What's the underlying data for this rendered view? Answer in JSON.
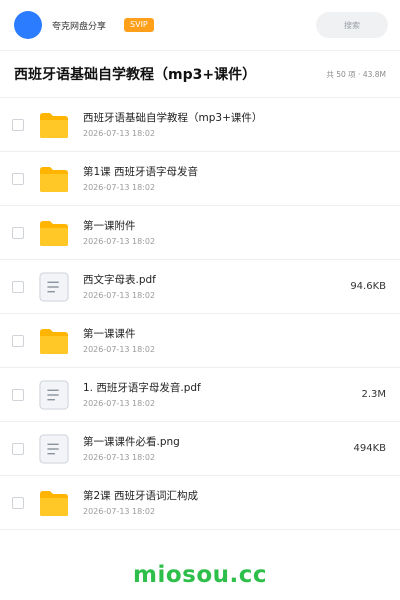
{
  "header": {
    "share_name": "夸克网盘分享",
    "badge": "SVIP",
    "search_placeholder": "搜索"
  },
  "title_bar": {
    "title": "西班牙语基础自学教程（mp3+课件）",
    "meta": "共 50 项 · 43.8M"
  },
  "files": [
    {
      "type": "folder",
      "name": "西班牙语基础自学教程（mp3+课件）",
      "date": "2026-07-13 18:02",
      "size": ""
    },
    {
      "type": "folder",
      "name": "第1课 西班牙语字母发音",
      "date": "2026-07-13 18:02",
      "size": ""
    },
    {
      "type": "folder",
      "name": "第一课附件",
      "date": "2026-07-13 18:02",
      "size": ""
    },
    {
      "type": "file",
      "name": "西文字母表.pdf",
      "date": "2026-07-13 18:02",
      "size": "94.6KB"
    },
    {
      "type": "folder",
      "name": "第一课课件",
      "date": "2026-07-13 18:02",
      "size": ""
    },
    {
      "type": "file",
      "name": "1. 西班牙语字母发音.pdf",
      "date": "2026-07-13 18:02",
      "size": "2.3M"
    },
    {
      "type": "file",
      "name": "第一课课件必看.png",
      "date": "2026-07-13 18:02",
      "size": "494KB"
    },
    {
      "type": "folder",
      "name": "第2课 西班牙语词汇构成",
      "date": "2026-07-13 18:02",
      "size": ""
    }
  ],
  "watermark": "miosou.cc",
  "colors": {
    "avatar": "#2b7cff",
    "badge": "#ff9f1a",
    "folder": "#ffc21a",
    "watermark": "#2dbf4a"
  },
  "icons": {
    "folder": "folder-icon",
    "file": "document-icon"
  }
}
